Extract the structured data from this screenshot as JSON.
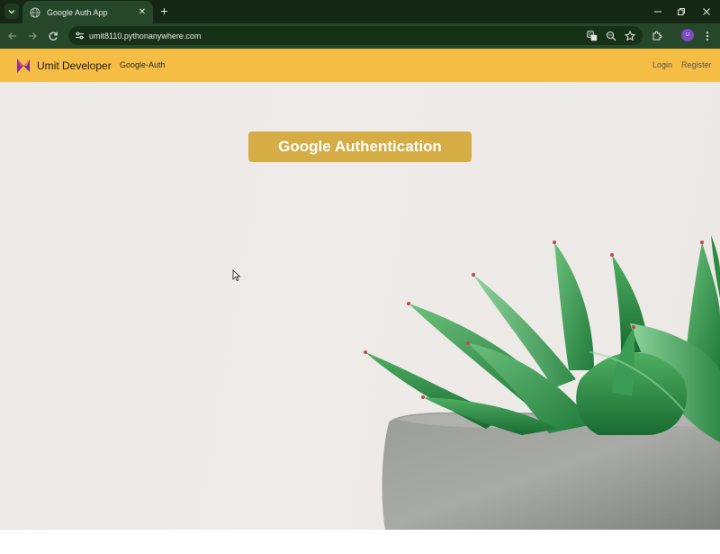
{
  "browser": {
    "tab_title": "Google Auth App",
    "url": "umit8110.pythonanywhere.com",
    "profile_initials": "U"
  },
  "navbar": {
    "brand": "Umit Developer",
    "nav_item": "Google-Auth",
    "login": "Login",
    "register": "Register",
    "bg_color": "#f6bd44"
  },
  "main": {
    "heading_button": "Google Authentication",
    "button_color": "#d6ac44"
  },
  "icons": {
    "tab_search": "chevron-down-icon",
    "globe": "globe-icon",
    "back": "arrow-left-icon",
    "forward": "arrow-right-icon",
    "reload": "reload-icon",
    "site_info": "tune-icon",
    "translate": "translate-icon",
    "zoom": "zoom-icon",
    "bookmark": "star-icon",
    "extensions": "puzzle-icon",
    "menu": "kebab-menu-icon",
    "brand_logo": "butterfly-logo-icon",
    "hero_image": "succulent-plant-image"
  }
}
